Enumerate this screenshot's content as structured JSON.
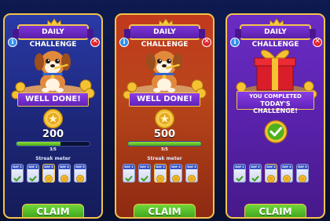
{
  "cards": [
    {
      "theme": "blue",
      "title": "DAILY CHALLENGE",
      "info_glyph": "i",
      "close_glyph": "✕",
      "ribbon": "WELL DONE!",
      "reward": "200",
      "progress_label": "3/5",
      "progress": 0.6,
      "streak_label": "Streak meter",
      "days": [
        {
          "label": "DAY 1",
          "state": "check"
        },
        {
          "label": "DAY 2",
          "state": "check"
        },
        {
          "label": "DAY 3",
          "state": "coin",
          "value": "300"
        },
        {
          "label": "DAY 4",
          "state": "coin",
          "value": "400"
        },
        {
          "label": "DAY 5",
          "state": "coin",
          "value": "500"
        }
      ],
      "claim_label": "CLAIM"
    },
    {
      "theme": "orange",
      "title": "DAILY CHALLENGE",
      "info_glyph": "i",
      "close_glyph": "✕",
      "ribbon": "WELL DONE!",
      "reward": "500",
      "progress_label": "5/5",
      "progress": 1.0,
      "streak_label": "Streak meter",
      "days": [
        {
          "label": "DAY 1",
          "state": "check"
        },
        {
          "label": "DAY 2",
          "state": "check"
        },
        {
          "label": "DAY 3",
          "state": "coin",
          "value": "300"
        },
        {
          "label": "DAY 4",
          "state": "coin",
          "value": "400"
        },
        {
          "label": "DAY 5",
          "state": "coin",
          "value": "500"
        }
      ],
      "claim_label": "CLAIM"
    },
    {
      "theme": "purple",
      "title": "DAILY CHALLENGE",
      "info_glyph": "i",
      "close_glyph": "✕",
      "ribbon_line1": "YOU COMPLETED",
      "ribbon_line2": "TODAY'S CHALLENGE!",
      "days": [
        {
          "label": "DAY 1",
          "state": "check"
        },
        {
          "label": "DAY 2",
          "state": "check"
        },
        {
          "label": "DAY 3",
          "state": "coin",
          "value": "300"
        },
        {
          "label": "DAY 4",
          "state": "coin",
          "value": "400"
        },
        {
          "label": "DAY 5",
          "state": "coin",
          "value": "500"
        }
      ],
      "claim_label": "CLAIM"
    }
  ],
  "colors": {
    "gold": "#f2c54a",
    "claim_green": "#4ba61a",
    "info_blue": "#2f8df0",
    "close_red": "#e2262c"
  }
}
